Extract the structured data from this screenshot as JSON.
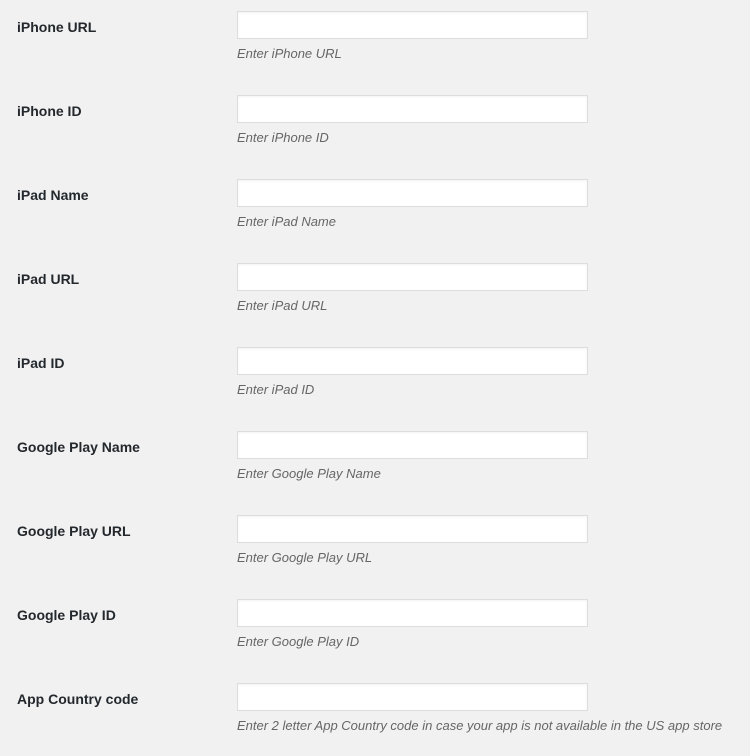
{
  "form": {
    "rows": [
      {
        "label": "iPhone URL",
        "value": "",
        "placeholder": "",
        "description": "Enter iPhone URL",
        "name": "iphone-url"
      },
      {
        "label": "iPhone ID",
        "value": "",
        "placeholder": "",
        "description": "Enter iPhone ID",
        "name": "iphone-id"
      },
      {
        "label": "iPad Name",
        "value": "",
        "placeholder": "",
        "description": "Enter iPad Name",
        "name": "ipad-name"
      },
      {
        "label": "iPad URL",
        "value": "",
        "placeholder": "",
        "description": "Enter iPad URL",
        "name": "ipad-url"
      },
      {
        "label": "iPad ID",
        "value": "",
        "placeholder": "",
        "description": "Enter iPad ID",
        "name": "ipad-id"
      },
      {
        "label": "Google Play Name",
        "value": "",
        "placeholder": "",
        "description": "Enter Google Play Name",
        "name": "google-play-name"
      },
      {
        "label": "Google Play URL",
        "value": "",
        "placeholder": "",
        "description": "Enter Google Play URL",
        "name": "google-play-url"
      },
      {
        "label": "Google Play ID",
        "value": "",
        "placeholder": "",
        "description": "Enter Google Play ID",
        "name": "google-play-id"
      },
      {
        "label": "App Country code",
        "value": "",
        "placeholder": "",
        "description": "Enter 2 letter App Country code in case your app is not available in the US app store",
        "name": "app-country-code"
      }
    ]
  },
  "colors": {
    "background": "#f1f1f1",
    "label_text": "#23282d",
    "description_text": "#666666",
    "input_background": "#ffffff",
    "input_border": "#dddddd"
  }
}
